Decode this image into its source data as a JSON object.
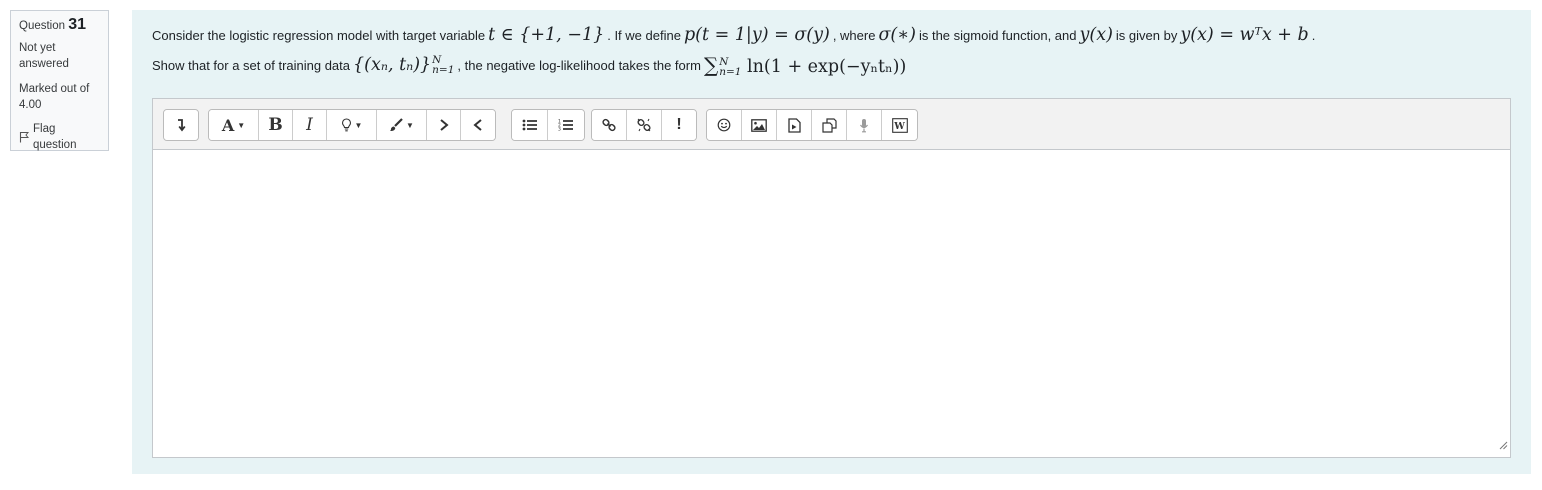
{
  "question": {
    "label": "Question",
    "number": "31",
    "state": "Not yet answered",
    "grade": "Marked out of 4.00",
    "flag_label": "Flag question"
  },
  "qtext": {
    "line1": {
      "t1": "Consider the logistic regression model with target variable",
      "m1": "t ∈ {+1, −1}",
      "t2": ". If we define",
      "m2": "p(t = 1|y) = σ(y)",
      "t3": ", where",
      "m3": "σ(∗)",
      "t4": "is the sigmoid function, and",
      "m4": "y(x)",
      "t5": "is given by",
      "m5": "y(x) = wᵀx + b",
      "t6": "."
    },
    "line2": {
      "t1": "Show that for a set of training data",
      "m1": "{(xₙ, tₙ)}",
      "m1_sup": "N",
      "m1_sub": "n=1",
      "t2": ", the negative log-likelihood takes the form",
      "m2_sum": "∑",
      "m2_sup": "N",
      "m2_sub": "n=1",
      "m2": "ln(1 + exp(−yₙtₙ))"
    }
  },
  "toolbar": {
    "groups": [
      [
        "show-more-icon"
      ],
      [
        "font-color-icon",
        "bold-icon",
        "italic-icon",
        "bulb-icon",
        "paint-brush-icon",
        "indent-icon",
        "outdent-icon"
      ],
      [
        "bullet-list-icon",
        "numbered-list-icon"
      ],
      [
        "link-icon",
        "unlink-icon",
        "exclamation-icon"
      ],
      [
        "emoji-icon",
        "image-icon",
        "media-icon",
        "manage-files-icon",
        "record-audio-icon",
        "word-paste-icon"
      ]
    ],
    "font_letter": "A",
    "bold_letter": "B",
    "italic_letter": "I",
    "exclamation": "!"
  },
  "colors": {
    "panel_bg": "#e7f3f5",
    "toolbar_bg": "#f2f2f2",
    "info_bg": "#f8f9fa"
  }
}
